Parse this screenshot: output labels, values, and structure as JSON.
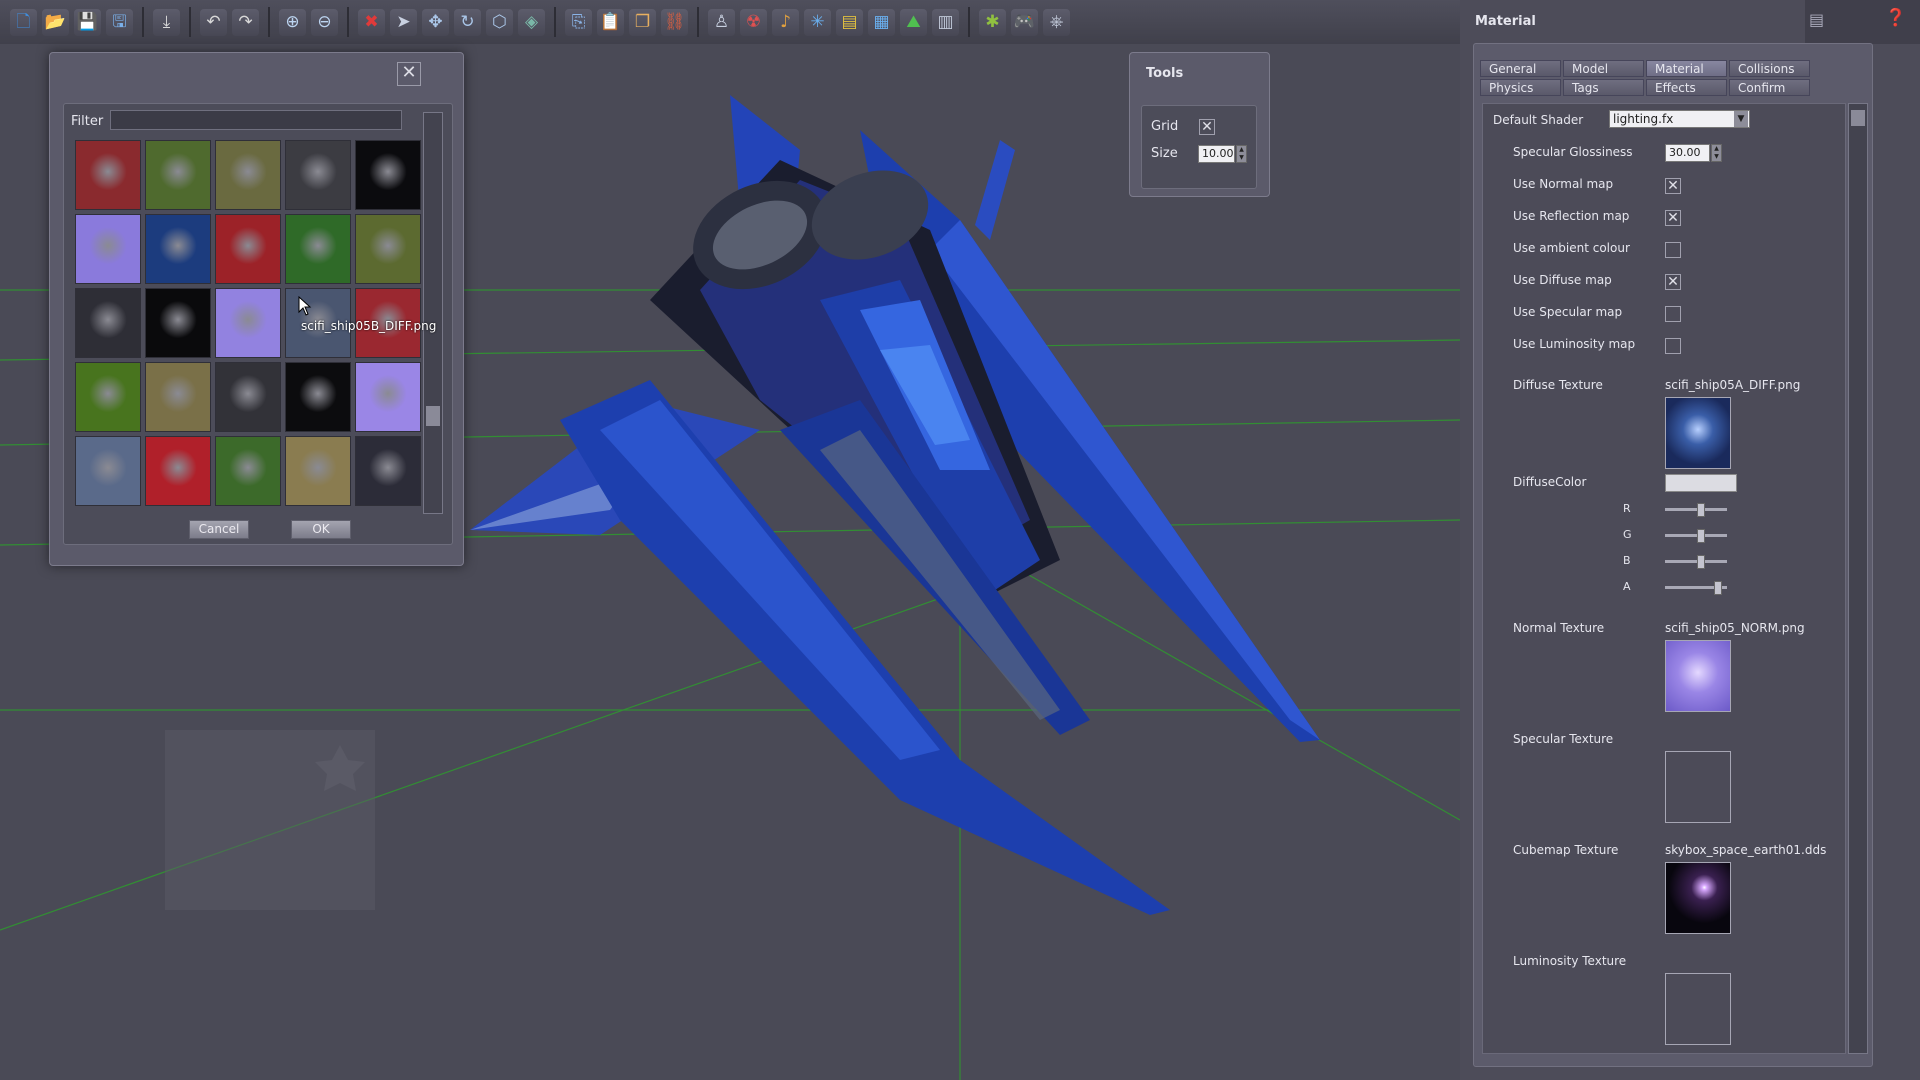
{
  "toolbar": {
    "groups": [
      [
        {
          "name": "new-file-icon",
          "glyph": "🗋",
          "color": "#3f8fe0"
        },
        {
          "name": "open-folder-icon",
          "glyph": "📂",
          "color": "#e8b040"
        },
        {
          "name": "save-icon",
          "glyph": "💾",
          "color": "#5a9fe8"
        },
        {
          "name": "save-as-icon",
          "glyph": "🖫",
          "color": "#7ab0ea"
        }
      ],
      [
        {
          "name": "import-icon",
          "glyph": "⤓",
          "color": "#d8d8d8"
        }
      ],
      [
        {
          "name": "undo-icon",
          "glyph": "↶",
          "color": "#d8d8d8"
        },
        {
          "name": "redo-icon",
          "glyph": "↷",
          "color": "#d8d8d8"
        }
      ],
      [
        {
          "name": "zoom-in-icon",
          "glyph": "⊕",
          "color": "#bcd4f0"
        },
        {
          "name": "zoom-out-icon",
          "glyph": "⊖",
          "color": "#bcd4f0"
        }
      ],
      [
        {
          "name": "delete-icon",
          "glyph": "✖",
          "color": "#e03a3a"
        },
        {
          "name": "select-arrow-icon",
          "glyph": "➤",
          "color": "#c8d0e0"
        },
        {
          "name": "move-icon",
          "glyph": "✥",
          "color": "#aac6e8"
        },
        {
          "name": "rotate-icon",
          "glyph": "↻",
          "color": "#aac6e8"
        },
        {
          "name": "scale-icon",
          "glyph": "⬡",
          "color": "#aac6e8"
        },
        {
          "name": "snap-icon",
          "glyph": "◈",
          "color": "#7ab8a8"
        }
      ],
      [
        {
          "name": "copy-icon",
          "glyph": "⎘",
          "color": "#8ab4e8"
        },
        {
          "name": "paste-icon",
          "glyph": "📋",
          "color": "#e8b060"
        },
        {
          "name": "duplicate-icon",
          "glyph": "❐",
          "color": "#e8b060"
        },
        {
          "name": "link-icon",
          "glyph": "⛓",
          "color": "#e06040"
        }
      ],
      [
        {
          "name": "character-icon",
          "glyph": "♙",
          "color": "#c8d0e0"
        },
        {
          "name": "enemy-icon",
          "glyph": "☢",
          "color": "#e05050"
        },
        {
          "name": "sound-icon",
          "glyph": "♪",
          "color": "#e0a040"
        },
        {
          "name": "particles-icon",
          "glyph": "✳",
          "color": "#6ab0f0"
        },
        {
          "name": "front-end-icon",
          "glyph": "▤",
          "color": "#e0c040"
        },
        {
          "name": "window-icon",
          "glyph": "▦",
          "color": "#6ab0f0"
        },
        {
          "name": "terrain-icon",
          "glyph": "⛰",
          "color": "#50c050"
        },
        {
          "name": "layout-icon",
          "glyph": "▥",
          "color": "#c0c8d8"
        }
      ],
      [
        {
          "name": "debug-bug-icon",
          "glyph": "✱",
          "color": "#90c040"
        },
        {
          "name": "play-game-icon",
          "glyph": "🎮",
          "color": "#e04040"
        },
        {
          "name": "gamepad-icon",
          "glyph": "⎈",
          "color": "#c0c8d8"
        }
      ]
    ]
  },
  "texture_dialog": {
    "close_symbol": "✕",
    "filter_label": "Filter",
    "filter_value": "",
    "thumbnails": [
      {
        "name": "thumb-red-ship",
        "bg": "#8a2a2e"
      },
      {
        "name": "thumb-green-ship",
        "bg": "#4f6a2e"
      },
      {
        "name": "thumb-olive-ship",
        "bg": "#6a6a40"
      },
      {
        "name": "thumb-grey-ship",
        "bg": "#3c3c42"
      },
      {
        "name": "thumb-black-lights",
        "bg": "#0b0b0e"
      },
      {
        "name": "thumb-normal-map",
        "bg": "#8a7adc"
      },
      {
        "name": "thumb-blue-ship",
        "bg": "#1c3c7e"
      },
      {
        "name": "thumb-red-ship-b",
        "bg": "#9c2228"
      },
      {
        "name": "thumb-green-ship-b",
        "bg": "#2f6a28"
      },
      {
        "name": "thumb-olive-ship-b",
        "bg": "#5c6a30"
      },
      {
        "name": "thumb-dark-ship",
        "bg": "#2e2e36"
      },
      {
        "name": "thumb-black-mask",
        "bg": "#0a0a0c"
      },
      {
        "name": "thumb-normal-map-b",
        "bg": "#9282e0"
      },
      {
        "name": "thumb-steel-ship",
        "bg": "#4a5670"
      },
      {
        "name": "thumb-red-blue-ship",
        "bg": "#9a2830"
      },
      {
        "name": "thumb-green-ship-c",
        "bg": "#48741e"
      },
      {
        "name": "thumb-tan-ship",
        "bg": "#7a7048"
      },
      {
        "name": "thumb-dark-ship-b",
        "bg": "#323238"
      },
      {
        "name": "thumb-black-mask-b",
        "bg": "#0c0c0e"
      },
      {
        "name": "thumb-normal-map-c",
        "bg": "#9a86e6"
      },
      {
        "name": "thumb-silver-ship",
        "bg": "#5a6a8a"
      },
      {
        "name": "thumb-red-ship-c",
        "bg": "#b0202a"
      },
      {
        "name": "thumb-green-ship-d",
        "bg": "#3c6a2a"
      },
      {
        "name": "thumb-tan-ship-b",
        "bg": "#8a7c50"
      },
      {
        "name": "thumb-dark-ship-c",
        "bg": "#2c2c38"
      }
    ],
    "tooltip": "scifi_ship05B_DIFF.png",
    "cancel_label": "Cancel",
    "ok_label": "OK"
  },
  "tools": {
    "title": "Tools",
    "grid_label": "Grid",
    "grid_checked": true,
    "size_label": "Size",
    "size_value": "10.00"
  },
  "material": {
    "title": "Material",
    "tabs": [
      {
        "label": "General",
        "active": false
      },
      {
        "label": "Model",
        "active": false
      },
      {
        "label": "Material",
        "active": true
      },
      {
        "label": "Collisions",
        "active": false
      },
      {
        "label": "Physics",
        "active": false
      },
      {
        "label": "Tags",
        "active": false
      },
      {
        "label": "Effects",
        "active": false
      },
      {
        "label": "Confirm",
        "active": false
      }
    ],
    "default_shader_label": "Default Shader",
    "default_shader_value": "lighting.fx",
    "specular_glossiness_label": "Specular Glossiness",
    "specular_glossiness_value": "30.00",
    "checks": [
      {
        "label": "Use Normal map",
        "checked": true
      },
      {
        "label": "Use Reflection map",
        "checked": true
      },
      {
        "label": "Use ambient colour",
        "checked": false
      },
      {
        "label": "Use Diffuse map",
        "checked": true
      },
      {
        "label": "Use Specular map",
        "checked": false
      },
      {
        "label": "Use Luminosity map",
        "checked": false
      }
    ],
    "diffuse_texture_label": "Diffuse Texture",
    "diffuse_texture_file": "scifi_ship05A_DIFF.png",
    "diffuse_color_label": "DiffuseColor",
    "diffuse_color_value": "#dcdce2",
    "rgba_labels": [
      "R",
      "G",
      "B",
      "A"
    ],
    "rgba_values": [
      0.55,
      0.55,
      0.55,
      0.85
    ],
    "normal_texture_label": "Normal Texture",
    "normal_texture_file": "scifi_ship05_NORM.png",
    "specular_texture_label": "Specular Texture",
    "cubemap_texture_label": "Cubemap Texture",
    "cubemap_texture_file": "skybox_space_earth01.dds",
    "luminosity_texture_label": "Luminosity Texture"
  },
  "colors": {
    "viewport_bg": "#4a4a56",
    "grid_line": "#2e9a2e",
    "ship_primary": "#1d3fae",
    "ship_dark": "#1a1d2e",
    "ship_grey": "#6c7384"
  }
}
